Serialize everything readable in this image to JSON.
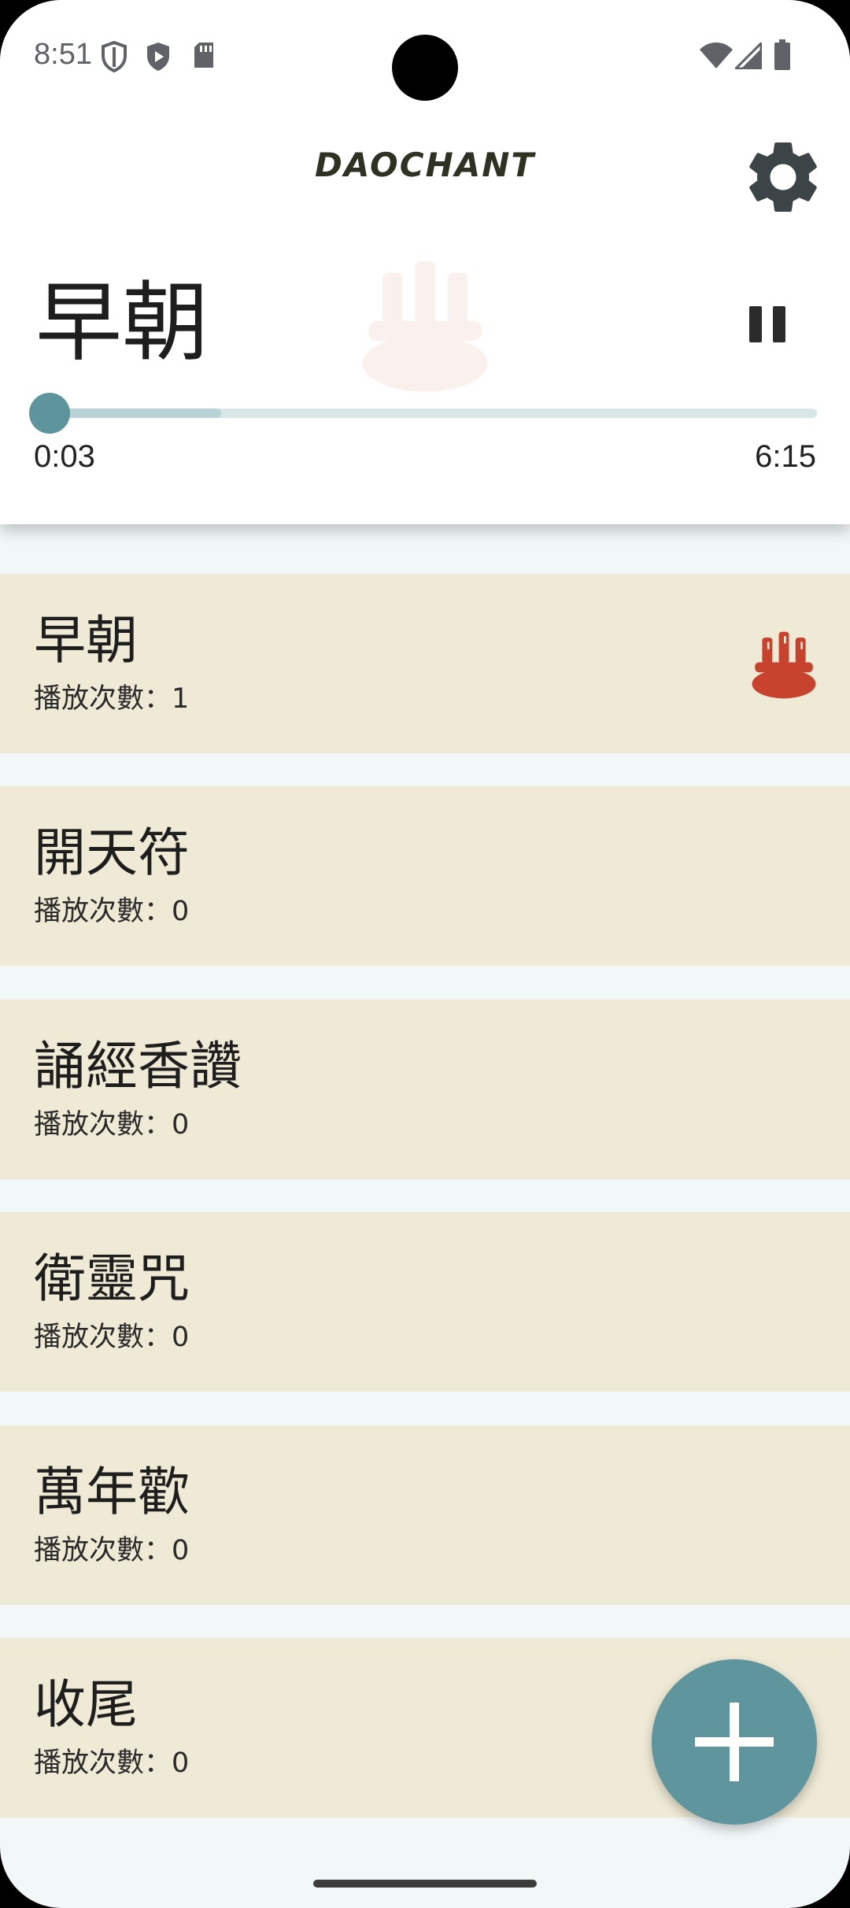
{
  "status_bar": {
    "time": "8:51",
    "left_icons": [
      "shield-icon",
      "play-protect-icon",
      "sd-card-icon"
    ],
    "right_icons": [
      "wifi-icon",
      "signal-icon",
      "battery-icon"
    ]
  },
  "header": {
    "title": "DAOCHANT",
    "settings_icon": "gear-icon"
  },
  "player": {
    "title": "早朝",
    "state": "playing",
    "current_time": "0:03",
    "total_time": "6:15",
    "progress": 0.008,
    "buffered": 0.23
  },
  "list": {
    "count_label": "播放次數：",
    "items": [
      {
        "title": "早朝",
        "count": "播放次數：1",
        "active": true
      },
      {
        "title": "開天符",
        "count": "播放次數：0"
      },
      {
        "title": "誦經香讚",
        "count": "播放次數：0"
      },
      {
        "title": "衛靈咒",
        "count": "播放次數：0"
      },
      {
        "title": "萬年歡",
        "count": "播放次數：0"
      },
      {
        "title": "收尾",
        "count": "播放次數：0"
      }
    ]
  },
  "fab": {
    "icon": "plus-icon"
  },
  "colors": {
    "accent": "#5F959D",
    "item_background": "#EFEAD5",
    "page_background": "#F2F7F8",
    "active_icon": "#C8432E"
  }
}
